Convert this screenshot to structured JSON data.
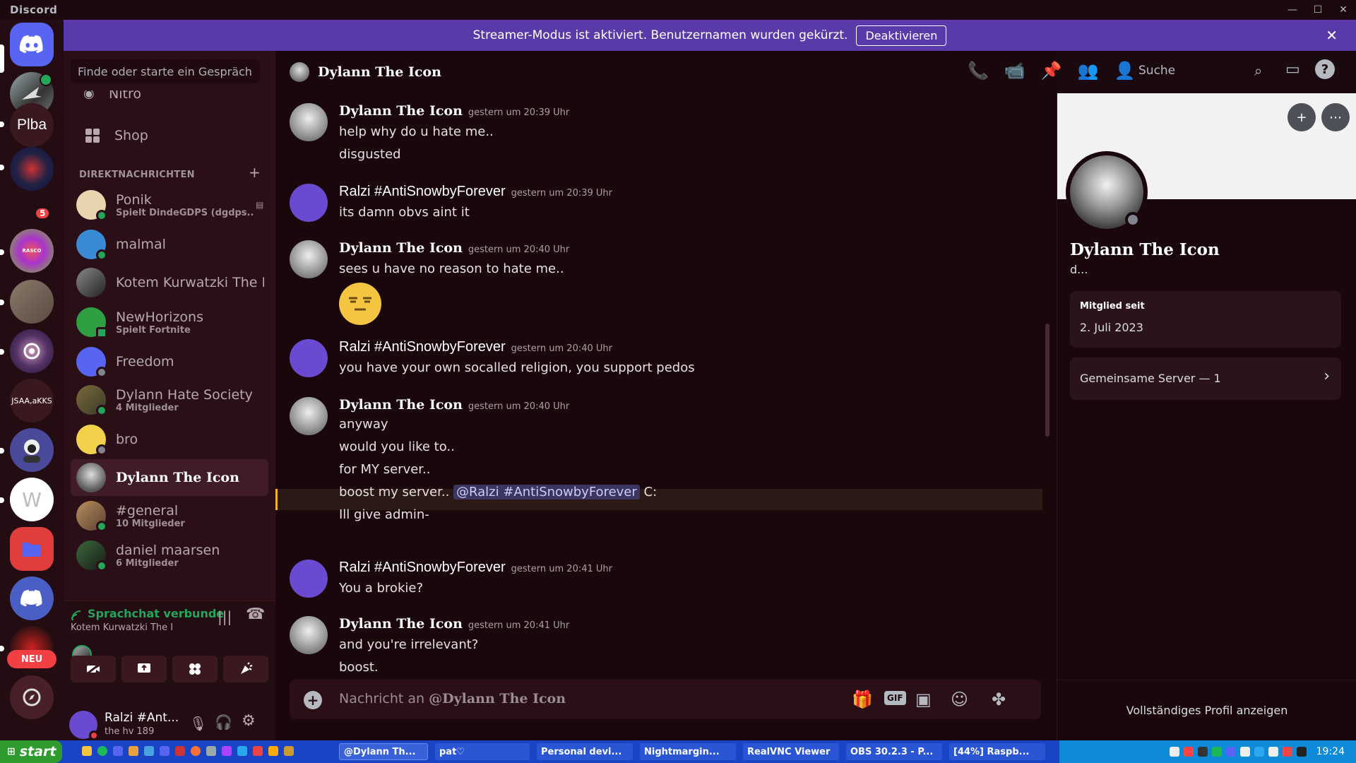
{
  "app": {
    "name": "Discord"
  },
  "banner": {
    "text": "Streamer-Modus ist aktiviert. Benutzernamen wurden gekürzt.",
    "button": "Deaktivieren"
  },
  "rail": {
    "server_plba": "Plba",
    "server_jsaa": "JSAA,aKKS",
    "badge_count": "5",
    "neu": "NEU"
  },
  "sidebar": {
    "search_placeholder": "Finde oder starte ein Gespräch",
    "nitro": "Nitro",
    "shop": "Shop",
    "dm_header": "DIREKTNACHRICHTEN",
    "dms": [
      {
        "name": "Ponik",
        "sub": "Spielt DindeGDPS (dgdps...."
      },
      {
        "name": "malmal",
        "sub": ""
      },
      {
        "name": "Kotem Kurwatzki The I",
        "sub": ""
      },
      {
        "name": "NewHorizons",
        "sub": "Spielt Fortnite"
      },
      {
        "name": "Freedom",
        "sub": ""
      },
      {
        "name": "Dylann Hate Society",
        "sub": "4 Mitglieder"
      },
      {
        "name": "bro",
        "sub": ""
      },
      {
        "name": "Dylann The Icon",
        "sub": ""
      },
      {
        "name": "#general",
        "sub": "10 Mitglieder"
      },
      {
        "name": "daniel maarsen",
        "sub": "6 Mitglieder"
      }
    ]
  },
  "voice": {
    "status": "Sprachchat verbunde",
    "channel": "Kotem Kurwatzki The I"
  },
  "user": {
    "name": "Ralzi #Ant...",
    "status": "the hv 189"
  },
  "chat": {
    "title": "Dylann The Icon",
    "search": "Suche",
    "composer_placeholder": "Nachricht an ",
    "composer_target": "@Dylann The Icon",
    "messages": [
      {
        "author": "Dylann The Icon",
        "time": "gestern um 20:39 Uhr",
        "lines": [
          "help why do u hate me..",
          "disgusted"
        ]
      },
      {
        "author": "Ralzi #AntiSnowbyForever",
        "time": "gestern um 20:39 Uhr",
        "lines": [
          "its damn obvs aint it"
        ]
      },
      {
        "author": "Dylann The Icon",
        "time": "gestern um 20:40 Uhr",
        "lines": [
          "sees u have no reason to hate me.."
        ]
      },
      {
        "author": "Ralzi #AntiSnowbyForever",
        "time": "gestern um 20:40 Uhr",
        "lines": [
          "you have your own socalled religion, you support pedos"
        ]
      },
      {
        "author": "Dylann The Icon",
        "time": "gestern um 20:40 Uhr",
        "lines": [
          "anyway",
          "would you like to..",
          "for MY server..",
          "boost my server.. ",
          "Ill give admin-"
        ],
        "mention": "@Ralzi #AntiSnowbyForever",
        "mention_tail": " C:"
      },
      {
        "author": "Ralzi #AntiSnowbyForever",
        "time": "gestern um 20:41 Uhr",
        "lines": [
          "You a brokie?"
        ]
      },
      {
        "author": "Dylann The Icon",
        "time": "gestern um 20:41 Uhr",
        "lines": [
          "and you're irrelevant?",
          "boost."
        ]
      }
    ]
  },
  "profile": {
    "name": "Dylann The Icon",
    "desc": "d...",
    "member_since_label": "Mitglied seit",
    "member_since": "2. Juli 2023",
    "mutual_servers": "Gemeinsame Server — 1",
    "full_profile": "Vollständiges Profil anzeigen"
  },
  "taskbar": {
    "start": "start",
    "tasks": [
      "@Dylann Th...",
      "pat♡",
      "Personal devi...",
      "Nightmargin...",
      "RealVNC Viewer",
      "OBS 30.2.3 - P...",
      "[44%] Raspb..."
    ],
    "clock": "19:24"
  }
}
